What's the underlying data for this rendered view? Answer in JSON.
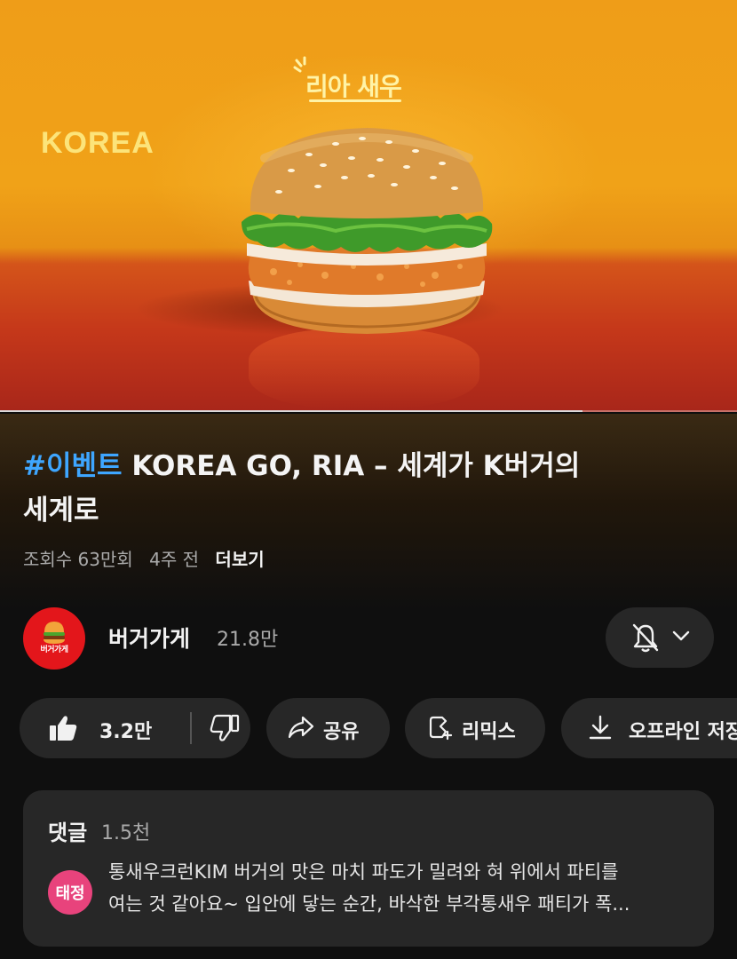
{
  "video": {
    "overlay_brand": "KOREA",
    "overlay_logo": "리아 새우",
    "progress_fraction": 0.79,
    "colors": {
      "background_orange": "#f0a218",
      "floor_red": "#c5381a"
    }
  },
  "title": {
    "hashtag": "#이벤트",
    "line1_rest": " KOREA GO, RIA – 세계가 K버거의",
    "line2": "세계로"
  },
  "meta": {
    "views": "조회수 63만회",
    "age": "4주 전",
    "more": "더보기"
  },
  "channel": {
    "name": "버거가게",
    "subscribers": "21.8만",
    "avatar_text": "버거가게",
    "avatar_icon": "burger-icon",
    "bell_icon": "bell-off-icon",
    "dropdown_icon": "chevron-down-icon"
  },
  "actions": {
    "like_count": "3.2만",
    "like_icon": "thumbs-up-icon",
    "dislike_icon": "thumbs-down-icon",
    "share_label": "공유",
    "share_icon": "share-icon",
    "remix_label": "리믹스",
    "remix_icon": "remix-icon",
    "download_label": "오프라인 저장",
    "download_icon": "download-icon"
  },
  "comments": {
    "heading": "댓글",
    "count": "1.5천",
    "top_comment": {
      "author_initials": "태정",
      "avatar_color": "#e8437c",
      "line1": "통새우크런KIM 버거의 맛은 마치 파도가 밀려와 혀 위에서 파티를",
      "line2": "여는 것 같아요~ 입안에 닿는 순간, 바삭한 부각통새우 패티가 폭..."
    }
  }
}
